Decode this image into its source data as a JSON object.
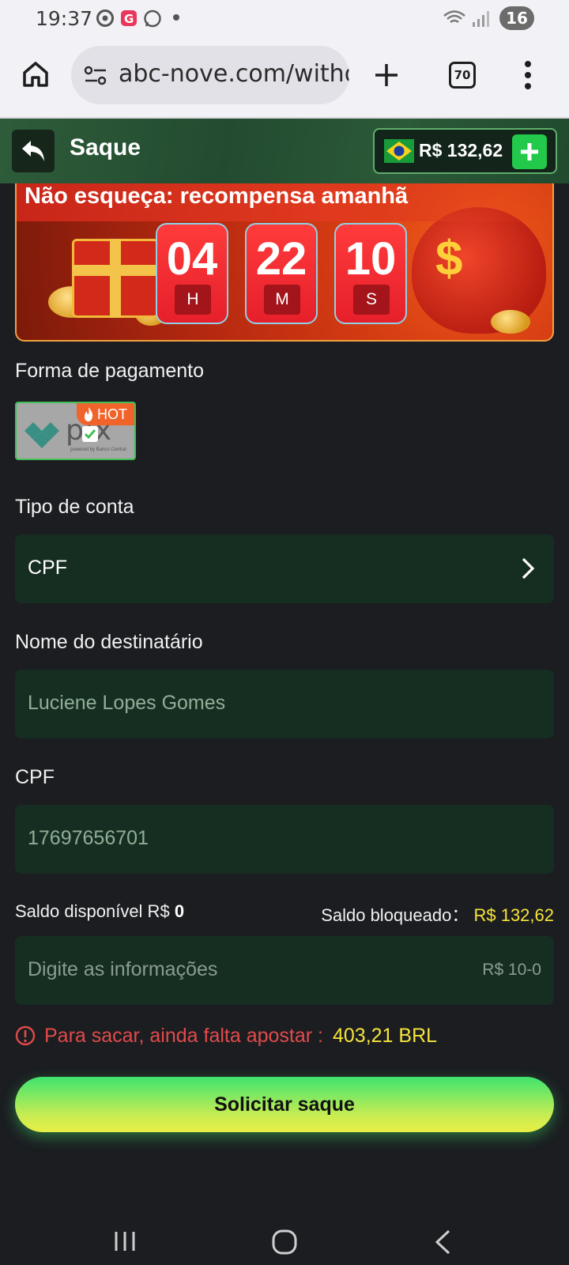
{
  "status_bar": {
    "time": "19:37",
    "battery": "16",
    "icons": [
      "chrome-icon",
      "g-app-icon",
      "whatsapp-icon",
      "dot-icon",
      "wifi-icon",
      "signal-icon"
    ]
  },
  "browser": {
    "url": "abc-nove.com/withdraw",
    "tab_count": "70",
    "icons": [
      "home-icon",
      "site-settings-icon",
      "new-tab-icon",
      "more-icon"
    ]
  },
  "header": {
    "title": "Saque",
    "balance": "R$ 132,62",
    "colors": {
      "bg": "#2e5c3a",
      "plus": "#22c94a"
    }
  },
  "banner": {
    "title": "Não esqueça: recompensa amanhã",
    "timer": [
      {
        "value": "04",
        "unit": "H"
      },
      {
        "value": "22",
        "unit": "M"
      },
      {
        "value": "10",
        "unit": "S"
      }
    ]
  },
  "payment": {
    "label": "Forma de pagamento",
    "method_logo_text": "pix",
    "method_sub": "powered by Banco Central",
    "hot_badge": "HOT"
  },
  "account_type": {
    "label": "Tipo de conta",
    "value": "CPF"
  },
  "recipient": {
    "label": "Nome do destinatário",
    "value": "Luciene Lopes Gomes"
  },
  "cpf": {
    "label": "CPF",
    "value": "17697656701"
  },
  "balances": {
    "available_label": "Saldo disponível R$",
    "available_value": "0",
    "blocked_label": "Saldo bloqueado：",
    "blocked_value": "R$ 132,62"
  },
  "amount": {
    "placeholder": "Digite as informações",
    "range": "R$ 10-0"
  },
  "warning": {
    "text": "Para sacar, ainda falta apostar :",
    "amount": "403,21 BRL"
  },
  "submit_label": "Solicitar saque",
  "colors": {
    "background": "#1b1d21",
    "field": "#162e22",
    "accent_yellow": "#f7e43a",
    "warning_red": "#e24a4a"
  }
}
